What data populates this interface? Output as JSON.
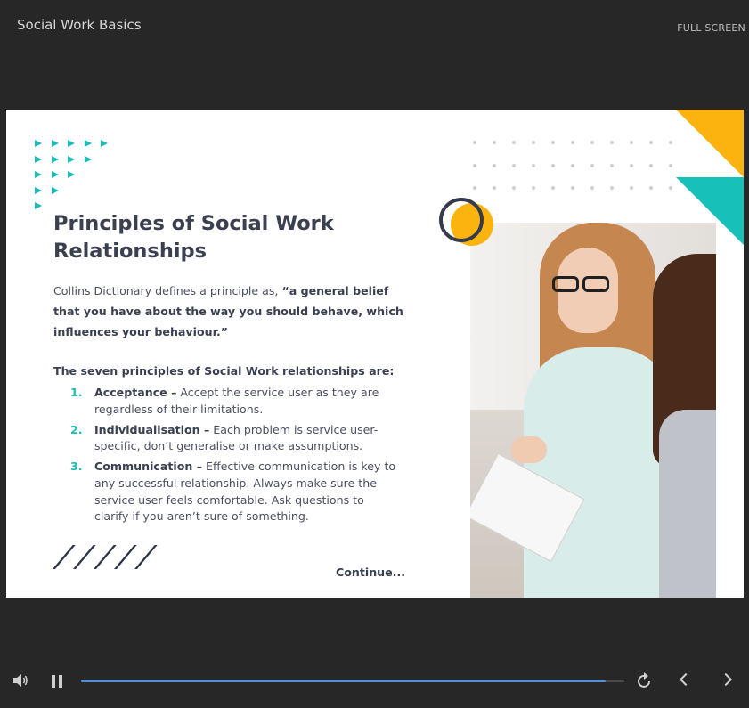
{
  "header": {
    "course_title": "Social Work Basics",
    "fullscreen_label": "FULL SCREEN"
  },
  "slide": {
    "title": "Principles of Social Work Relationships",
    "intro_prefix": "Collins Dictionary defines a principle as, ",
    "intro_quote": "“a general belief that you have about the way you should behave, which influences your behaviour.”",
    "list_heading": "The seven principles of Social Work relationships are:",
    "principles": [
      {
        "number": "1.",
        "term": "Acceptance –",
        "description": " Accept the service user as they are regardless of their limitations."
      },
      {
        "number": "2.",
        "term": "Individualisation –",
        "description": " Each problem is service user-specific, don’t generalise or make assumptions."
      },
      {
        "number": "3.",
        "term": "Communication –",
        "description": " Effective communication is key to any successful relationship. Always make sure the service user feels comfortable. Ask questions to clarify if you aren’t sure of something."
      }
    ],
    "continue_label": "Continue...",
    "colors": {
      "teal": "#1bbdb6",
      "yellow": "#fbb40f",
      "navy": "#353a4c"
    }
  },
  "player": {
    "progress": 0.965,
    "icons": [
      "volume-icon",
      "pause-icon",
      "replay-icon",
      "prev-icon",
      "next-icon"
    ]
  }
}
